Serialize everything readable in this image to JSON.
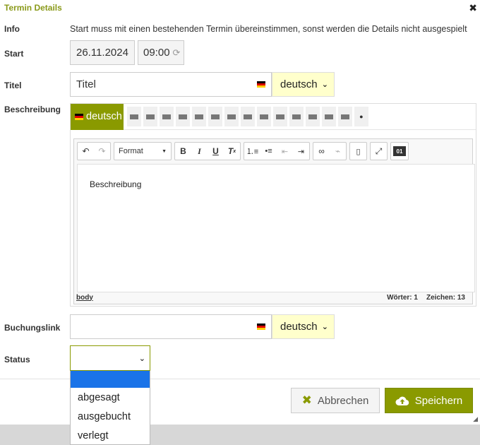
{
  "dialog": {
    "title": "Termin Details",
    "close_symbol": "✖"
  },
  "labels": {
    "info": "Info",
    "start": "Start",
    "titel": "Titel",
    "beschreibung": "Beschreibung",
    "buchungslink": "Buchungslink",
    "status": "Status"
  },
  "info_text": "Start muss mit einen bestehenden Termin übereinstimmen, sonst werden die Details nicht ausgespielt",
  "start": {
    "date": "26.11.2024",
    "time": "09:00"
  },
  "titel": {
    "value": "Titel",
    "language": "deutsch"
  },
  "beschreibung": {
    "active_language": "deutsch",
    "other_language_count": 15,
    "toolbar": {
      "format_label": "Format"
    },
    "content": "Beschreibung",
    "status_path": "body",
    "word_count": "Wörter: 1",
    "char_count": "Zeichen: 13"
  },
  "buchungslink": {
    "value": "",
    "language": "deutsch"
  },
  "status": {
    "selected": "",
    "options": [
      "",
      "abgesagt",
      "ausgebucht",
      "verlegt"
    ]
  },
  "buttons": {
    "cancel": "Abbrechen",
    "save": "Speichern"
  },
  "colors": {
    "accent": "#8a9a00",
    "language_select_bg": "#ffffcc",
    "selected_option": "#1a73e8"
  }
}
